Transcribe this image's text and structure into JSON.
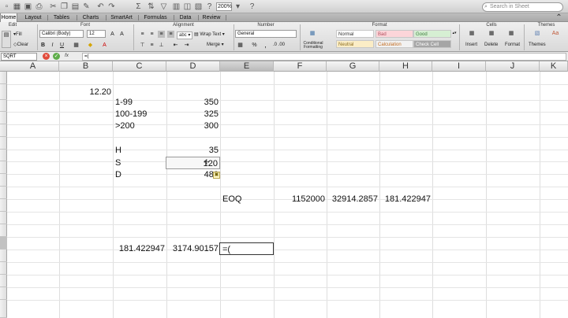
{
  "toolbar": {
    "zoom": "200%",
    "search_placeholder": "Search in Sheet"
  },
  "tabs": [
    "Home",
    "Layout",
    "Tables",
    "Charts",
    "SmartArt",
    "Formulas",
    "Data",
    "Review"
  ],
  "ribbon": {
    "groups": [
      "Edit",
      "Font",
      "Alignment",
      "Number",
      "Format",
      "Cells",
      "Themes"
    ],
    "fill_label": "Fill",
    "clear_label": "Clear",
    "font_name": "Calibri (Body)",
    "font_size": "12",
    "wrap_text": "Wrap Text",
    "merge": "Merge",
    "number_format": "General",
    "conditional_formatting": "Conditional Formatting",
    "styles": {
      "normal": "Normal",
      "bad": "Bad",
      "good": "Good",
      "neutral": "Neutral",
      "calculation": "Calculation",
      "check_cell": "Check Cell"
    },
    "cells_buttons": [
      "Insert",
      "Delete",
      "Format"
    ],
    "themes_button": "Themes"
  },
  "formula_bar": {
    "name_box": "SQRT",
    "fx": "fx",
    "formula": "=("
  },
  "columns": [
    "A",
    "B",
    "C",
    "D",
    "E",
    "F",
    "G",
    "H",
    "I",
    "J",
    "K"
  ],
  "selected_column": "E",
  "cells": {
    "b1": "12.20",
    "c2": "1-99",
    "d2": "350",
    "c3": "100-199",
    "d3": "325",
    "c4": ">200",
    "d4": "300",
    "c6": "H",
    "d6": "35",
    "c7": "S",
    "d7": "120",
    "c8": "D",
    "d8": "480",
    "e10": "EOQ",
    "f10": "1152000",
    "g10": "32914.2857",
    "h10": "181.422947",
    "c14": "181.422947",
    "d14": "3174.90157",
    "e14": "=("
  }
}
